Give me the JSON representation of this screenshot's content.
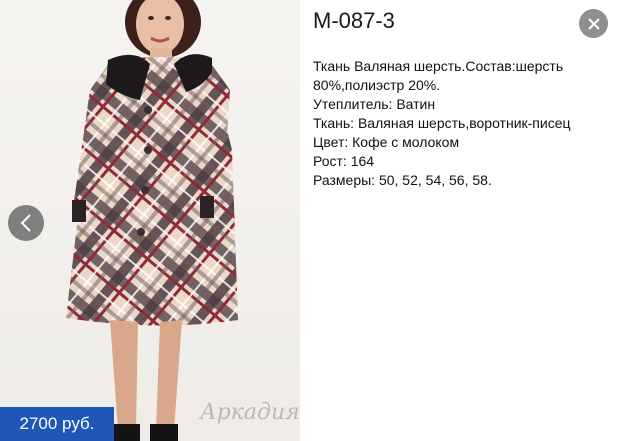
{
  "product": {
    "code": "М-087-3",
    "price": "2700 руб.",
    "watermark": "Аркадия",
    "description_lines": [
      "Ткань Валяная шерсть.Состав:шерсть",
      "80%,полиэстр 20%.",
      "Утеплитель: Ватин",
      "Ткань: Валяная шерсть,воротник-писец",
      "Цвет: Кофе с молоком",
      "Рост: 164",
      "Размеры: 50, 52, 54, 56, 58."
    ]
  },
  "icons": {
    "prev": "chevron-left-icon",
    "close": "close-icon"
  },
  "colors": {
    "price_bg": "#1f57b8",
    "close_bg": "#8f8f8f",
    "coat_base": "#e8d6c4",
    "coat_dark": "#4a3a3e",
    "coat_red": "#8e2a3a"
  }
}
